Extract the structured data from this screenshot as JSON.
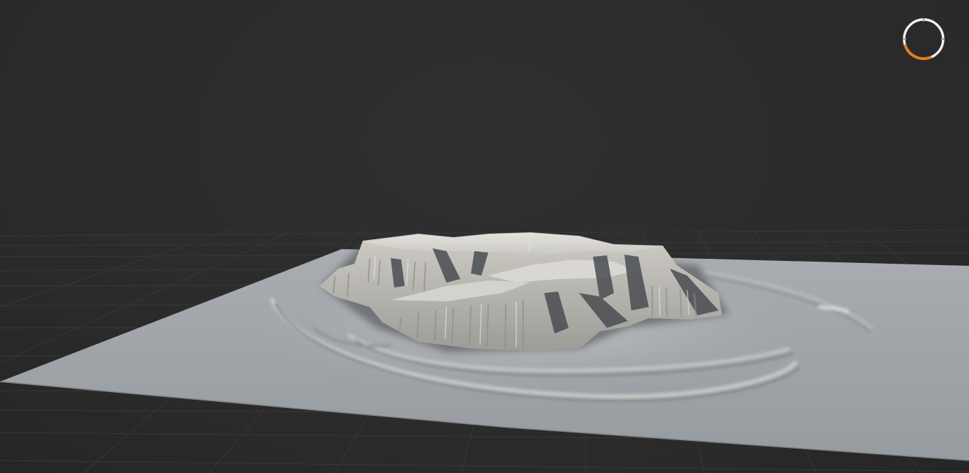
{
  "viewport": {
    "background_color": "#2b2b2b",
    "grid_color": "#3a3a3a",
    "terrain_plane_color": "#9fa4a8",
    "terrain_highlight_color": "#d9d8d3",
    "terrain_shadow_color": "#3e4146"
  },
  "progress_indicator": {
    "icon": "loading-ring-icon",
    "progress_fraction": 0.25,
    "track_color": "#f2f2f2",
    "accent_color": "#e87c1e"
  }
}
